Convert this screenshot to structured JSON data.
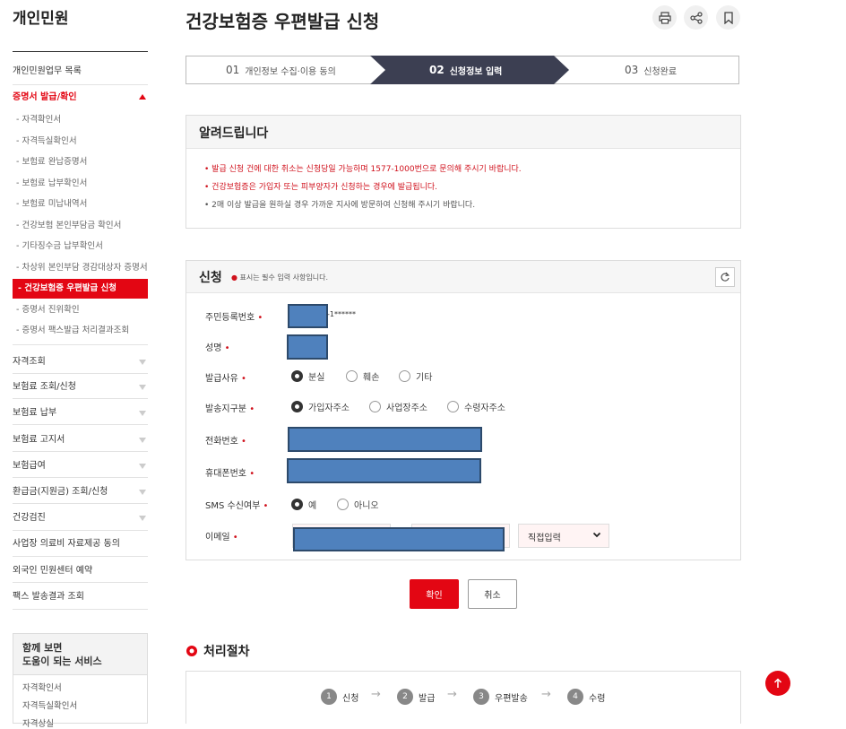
{
  "sidebar": {
    "title": "개인민원",
    "top_item": "개인민원업무 목록",
    "active_section": "증명서 발급/확인",
    "sub_items": [
      "자격확인서",
      "자격득실확인서",
      "보험료 완납증명서",
      "보험료 납부확인서",
      "보험료 미납내역서",
      "건강보험 본인부담금 확인서",
      "기타징수금 납부확인서",
      "차상위 본인부담 경감대상자 증명서",
      "건강보험증 우편발급 신청",
      "증명서 진위확인",
      "증명서 팩스발급 처리결과조회"
    ],
    "active_sub": "건강보험증 우편발급 신청",
    "collapsed_items": [
      "자격조회",
      "보험료 조회/신청",
      "보험료 납부",
      "보험료 고지서",
      "보험급여",
      "환급금(지원금) 조회/신청",
      "건강검진"
    ],
    "plain_items": [
      "사업장 의료비 자료제공 동의",
      "외국인 민원센터 예약",
      "팩스 발송결과 조회"
    ],
    "related": {
      "title_line1": "함께 보면",
      "title_line2": "도움이 되는 서비스",
      "links": [
        "자격확인서",
        "자격득실확인서",
        "자격상실"
      ]
    }
  },
  "header": {
    "title": "건강보험증 우편발급 신청",
    "icons": [
      "print-icon",
      "share-icon",
      "bookmark-icon"
    ]
  },
  "steps": [
    {
      "no": "01",
      "label": "개인정보 수집·이용 동의"
    },
    {
      "no": "02",
      "label": "신청정보 입력"
    },
    {
      "no": "03",
      "label": "신청완료"
    }
  ],
  "notice": {
    "title": "알려드립니다",
    "items": [
      "발급 신청 건에 대한 취소는 신청당일 가능하며 1577-1000번으로 문의해 주시기 바랍니다.",
      "건강보험증은 가입자 또는 피부양자가 신청하는 경우에 발급됩니다.",
      "2매 이상 발급을 원하실 경우 가까운 지사에 방문하여 신청해 주시기 바랍니다."
    ]
  },
  "form": {
    "title": "신청",
    "required_note": "표시는 필수 입력 사항입니다.",
    "rrn_label": "주민등록번호",
    "rrn_suffix": "-1******",
    "name_label": "성명",
    "reason_label": "발급사유",
    "reason_options": [
      "분실",
      "훼손",
      "기타"
    ],
    "reason_selected": "분실",
    "ship_label": "발송지구분",
    "ship_options": [
      "가입자주소",
      "사업장주소",
      "수령자주소"
    ],
    "ship_selected": "가입자주소",
    "phone_label": "전화번호",
    "mobile_label": "휴대폰번호",
    "sms_label": "SMS 수신여부",
    "sms_options": [
      "예",
      "아니오"
    ],
    "sms_selected": "예",
    "email_label": "이메일",
    "email_domain_select": "직접입력"
  },
  "buttons": {
    "ok": "확인",
    "cancel": "취소"
  },
  "process": {
    "title": "처리절차",
    "steps": [
      {
        "no": "1",
        "label": "신청"
      },
      {
        "no": "2",
        "label": "발급"
      },
      {
        "no": "3",
        "label": "우편발송"
      },
      {
        "no": "4",
        "label": "수령"
      }
    ]
  },
  "colors": {
    "accent": "#e30613",
    "step_active": "#3c3f52",
    "redaction": "#4f81bd"
  }
}
